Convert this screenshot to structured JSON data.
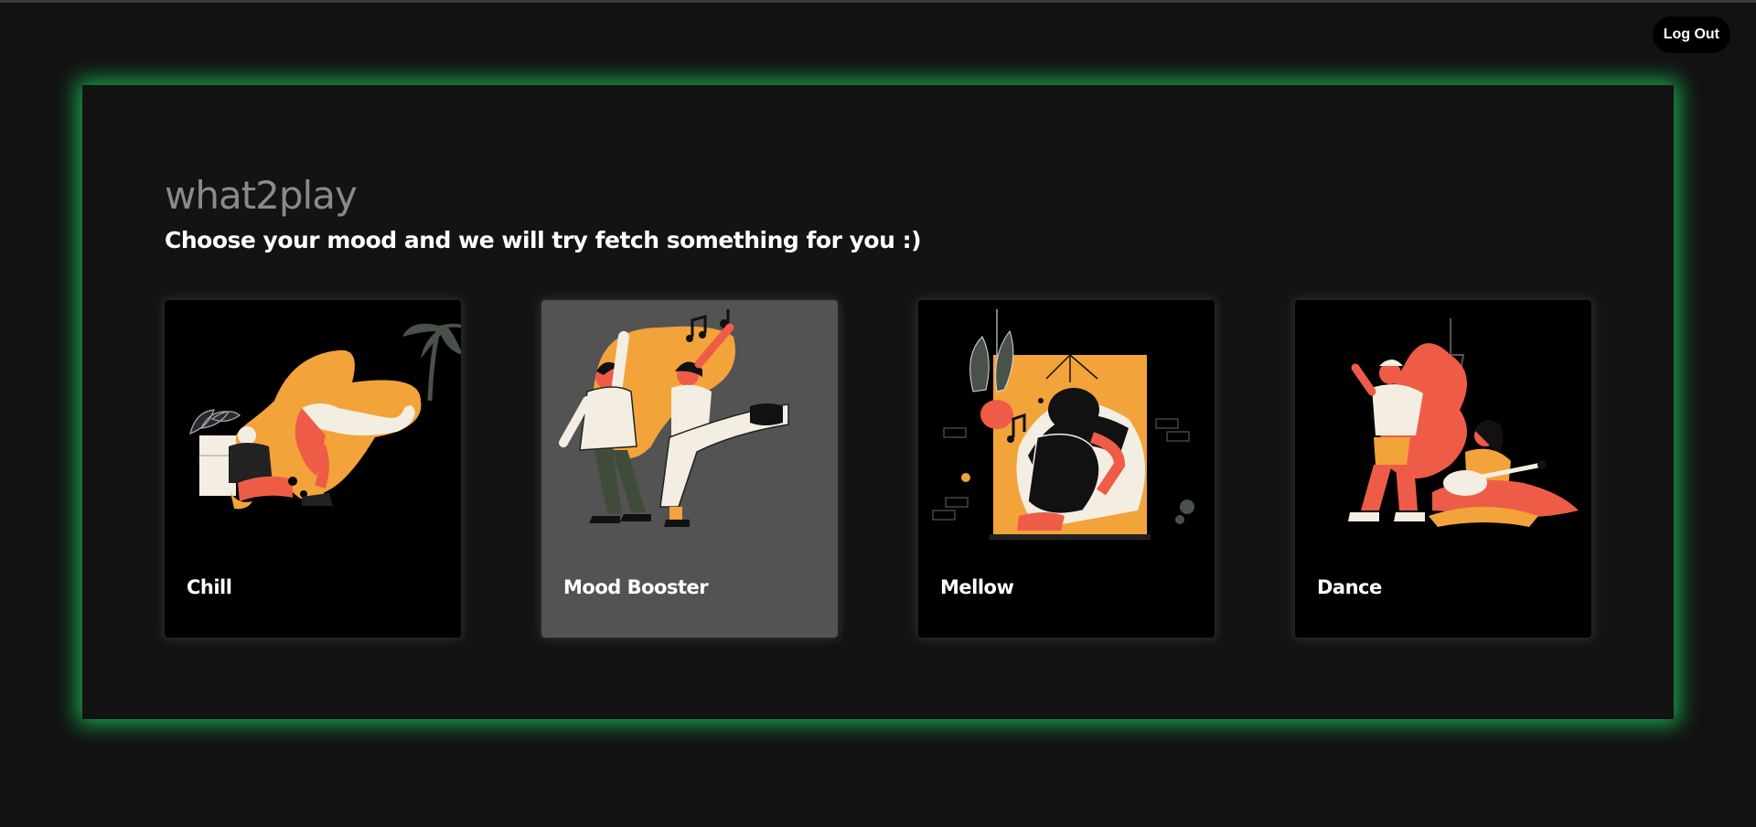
{
  "header": {
    "logout_label": "Log Out"
  },
  "main": {
    "brand": "what2play",
    "subtitle": "Choose your mood and we will try fetch something for you :)"
  },
  "moods": [
    {
      "label": "Chill",
      "active": false
    },
    {
      "label": "Mood Booster",
      "active": true
    },
    {
      "label": "Mellow",
      "active": false
    },
    {
      "label": "Dance",
      "active": false
    }
  ],
  "colors": {
    "background": "#121212",
    "panel": "#131313",
    "accent_glow": "#1ED760",
    "card": "#000000",
    "card_active": "#535353",
    "illustration_orange": "#F2A33A",
    "illustration_red": "#EE5C48",
    "illustration_cream": "#F4EEE2"
  },
  "icons": [
    "chill-illustration",
    "mood-booster-illustration",
    "mellow-illustration",
    "dance-illustration"
  ]
}
